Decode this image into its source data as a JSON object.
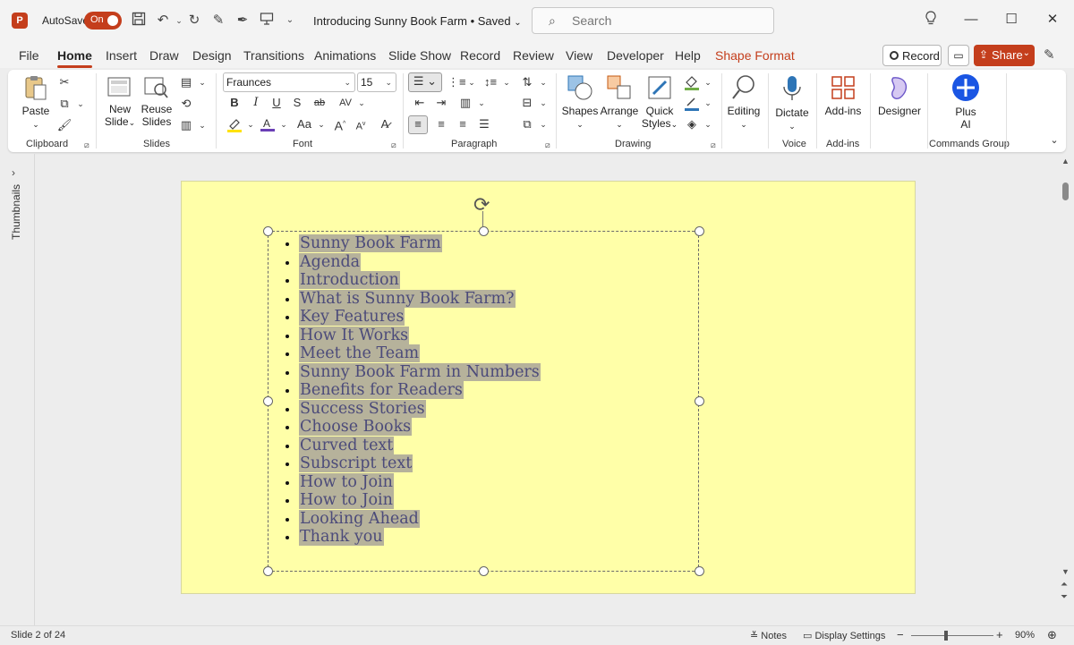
{
  "titlebar": {
    "autosave_label": "AutoSave",
    "autosave_state": "On",
    "doc_title": "Introducing Sunny Book Farm • Saved",
    "search_placeholder": "Search"
  },
  "tabs": [
    "File",
    "Home",
    "Insert",
    "Draw",
    "Design",
    "Transitions",
    "Animations",
    "Slide Show",
    "Record",
    "Review",
    "View",
    "Developer",
    "Help",
    "Shape Format"
  ],
  "active_tab": "Home",
  "actions": {
    "record": "Record",
    "share": "Share"
  },
  "ribbon": {
    "clipboard": {
      "paste": "Paste",
      "label": "Clipboard"
    },
    "slides": {
      "new_slide_1": "New",
      "new_slide_2": "Slide",
      "reuse_1": "Reuse",
      "reuse_2": "Slides",
      "label": "Slides"
    },
    "font": {
      "family": "Fraunces",
      "size": "15",
      "label": "Font",
      "bold": "B",
      "italic": "I",
      "underline": "U",
      "shadow": "S",
      "strike": "ab",
      "spacing": "AV",
      "case": "Aa",
      "grow": "A",
      "shrink": "A"
    },
    "paragraph": {
      "label": "Paragraph"
    },
    "drawing": {
      "shapes": "Shapes",
      "arrange": "Arrange",
      "quick_styles_1": "Quick",
      "quick_styles_2": "Styles",
      "label": "Drawing"
    },
    "editing": {
      "label": "Editing"
    },
    "voice": {
      "dictate": "Dictate",
      "label": "Voice"
    },
    "addins": {
      "addins": "Add-ins",
      "label": "Add-ins"
    },
    "designer": {
      "label": "Designer"
    },
    "commands": {
      "plus_1": "Plus",
      "plus_2": "AI",
      "label": "Commands Group"
    }
  },
  "side_panel": {
    "label": "Thumbnails"
  },
  "slide": {
    "bullets": [
      "Sunny Book Farm",
      "Agenda",
      "Introduction",
      "What is Sunny Book Farm?",
      "Key Features",
      "How It Works",
      "Meet the Team",
      "Sunny Book Farm in Numbers",
      "Benefits for Readers",
      "Success Stories",
      "Choose Books",
      "Curved text",
      "Subscript text",
      "How to Join",
      "How to Join",
      "Looking Ahead",
      "Thank you"
    ]
  },
  "status": {
    "slide_counter": "Slide 2 of 24",
    "notes": "Notes",
    "display_settings": "Display Settings",
    "zoom": "90%",
    "zoom_fraction": 0.42
  },
  "colors": {
    "accent": "#c43e1c",
    "slide_bg": "#ffffa8",
    "highlight": "#b6b29b",
    "text": "#4c4b7a"
  }
}
